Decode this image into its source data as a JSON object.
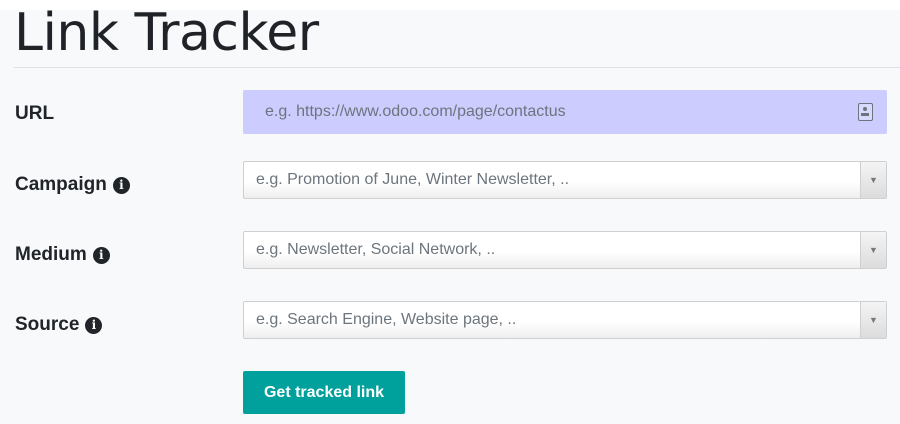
{
  "page": {
    "title": "Link Tracker"
  },
  "form": {
    "url": {
      "label": "URL",
      "placeholder": "e.g. https://www.odoo.com/page/contactus",
      "value": ""
    },
    "campaign": {
      "label": "Campaign",
      "placeholder": "e.g. Promotion of June, Winter Newsletter, .."
    },
    "medium": {
      "label": "Medium",
      "placeholder": "e.g. Newsletter, Social Network, .."
    },
    "source": {
      "label": "Source",
      "placeholder": "e.g. Search Engine, Website page, .."
    },
    "submit_label": "Get tracked link"
  },
  "icons": {
    "info": "info-circle-icon",
    "clipboard": "clipboard-icon",
    "dropdown": "caret-down-icon"
  },
  "colors": {
    "url_field_bg": "#ccccff",
    "button_bg": "#00a09d",
    "page_bg": "#f8f9fb"
  }
}
